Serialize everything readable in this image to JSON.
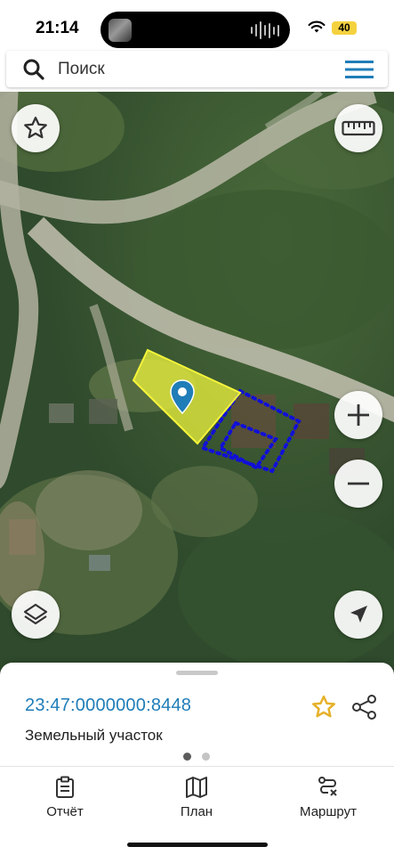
{
  "status_bar": {
    "time": "21:14",
    "battery": "40"
  },
  "search": {
    "placeholder": "Поиск"
  },
  "parcel": {
    "cadastral_number": "23:47:0000000:8448",
    "type": "Земельный участок"
  },
  "pager": {
    "pages": 2,
    "active": 0
  },
  "bottom_nav": {
    "items": [
      {
        "label": "Отчёт",
        "icon": "report-icon"
      },
      {
        "label": "План",
        "icon": "map-plan-icon"
      },
      {
        "label": "Маршрут",
        "icon": "route-icon"
      }
    ]
  },
  "map_controls": [
    "favorite-star-icon",
    "ruler-icon",
    "zoom-in-icon",
    "zoom-out-icon",
    "layers-icon",
    "location-arrow-icon"
  ],
  "colors": {
    "accent": "#1f7db8",
    "star": "#e6b12a",
    "parcel_fill": "#e8ee3c",
    "neighbor_dots": "#1010d8",
    "pin": "#1f7db8"
  }
}
